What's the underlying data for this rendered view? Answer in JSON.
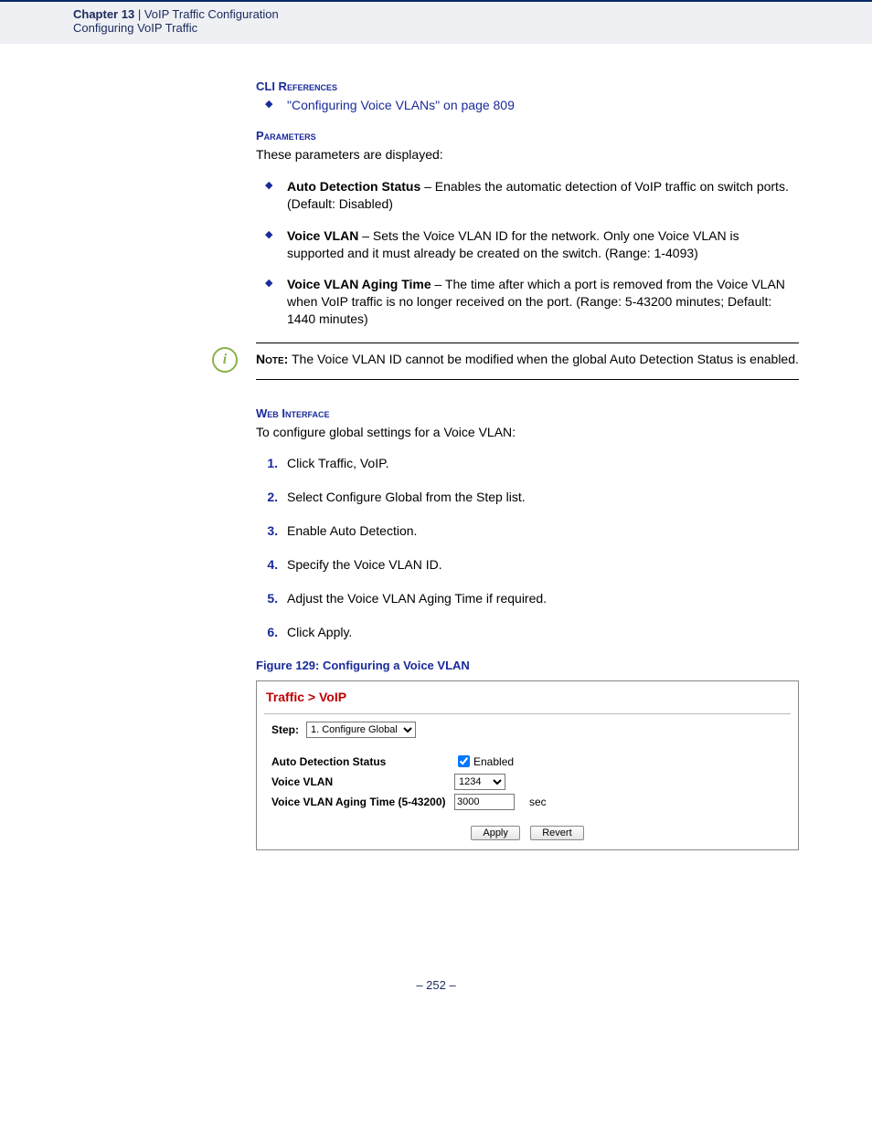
{
  "header": {
    "chapter_label": "Chapter 13",
    "chapter_sep": "  |  ",
    "chapter_title": "VoIP Traffic Configuration",
    "subtitle": "Configuring VoIP Traffic"
  },
  "cli": {
    "heading": "CLI References",
    "link": "\"Configuring Voice VLANs\" on page 809"
  },
  "params": {
    "heading": "Parameters",
    "intro": "These parameters are displayed:",
    "items": [
      {
        "name": "Auto Detection Status",
        "desc": " – Enables the automatic detection of VoIP traffic on switch ports. (Default: Disabled)"
      },
      {
        "name": "Voice VLAN",
        "desc": " – Sets the Voice VLAN ID for the network. Only one Voice VLAN is supported and it must already be created on the switch. (Range: 1-4093)"
      },
      {
        "name": "Voice VLAN Aging Time",
        "desc": " – The time after which a port is removed from the Voice VLAN when VoIP traffic is no longer received on the port. (Range: 5-43200 minutes; Default: 1440 minutes)"
      }
    ]
  },
  "note": {
    "label": "Note:",
    "text": " The Voice VLAN ID cannot be modified when the global Auto Detection Status is enabled."
  },
  "web": {
    "heading": "Web Interface",
    "intro": "To configure global settings for a Voice VLAN:",
    "steps": [
      "Click Traffic, VoIP.",
      "Select Configure Global from the Step list.",
      "Enable Auto Detection.",
      "Specify the Voice VLAN ID.",
      "Adjust the Voice VLAN Aging Time if required.",
      "Click Apply."
    ]
  },
  "figure": {
    "title": "Figure 129:  Configuring a Voice VLAN",
    "breadcrumb": "Traffic > VoIP",
    "step_label": "Step:",
    "step_value": "1. Configure Global",
    "rows": {
      "auto_detect_label": "Auto Detection Status",
      "auto_detect_check_label": "Enabled",
      "voice_vlan_label": "Voice VLAN",
      "voice_vlan_value": "1234",
      "aging_label": "Voice VLAN Aging Time (5-43200)",
      "aging_value": "3000",
      "aging_unit": "sec"
    },
    "buttons": {
      "apply": "Apply",
      "revert": "Revert"
    }
  },
  "page_number": "– 252 –"
}
